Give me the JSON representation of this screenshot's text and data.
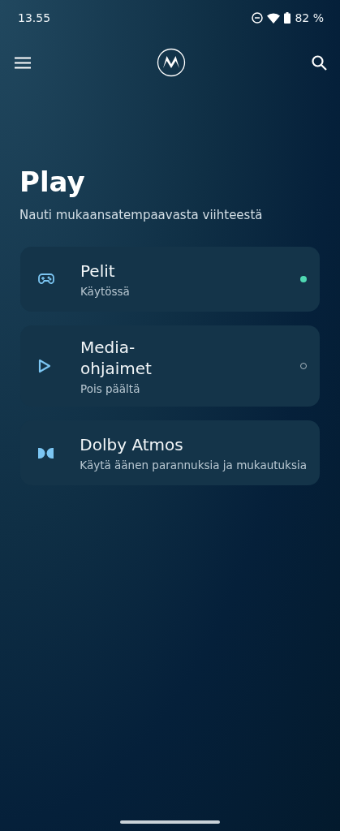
{
  "status_bar": {
    "time": "13.55",
    "battery": "82 %"
  },
  "header": {
    "title": "Play",
    "subtitle": "Nauti mukaansatempaavasta viihteestä"
  },
  "items": [
    {
      "kind": "game",
      "title": "Pelit",
      "subtitle": "Käytössä",
      "on": true
    },
    {
      "kind": "play",
      "title": "Media-ohjaimet",
      "subtitle": "Pois päältä",
      "on": false
    },
    {
      "kind": "dolby",
      "title": "Dolby Atmos",
      "subtitle": "Käytä äänen parannuksia ja mukautuksia"
    }
  ]
}
